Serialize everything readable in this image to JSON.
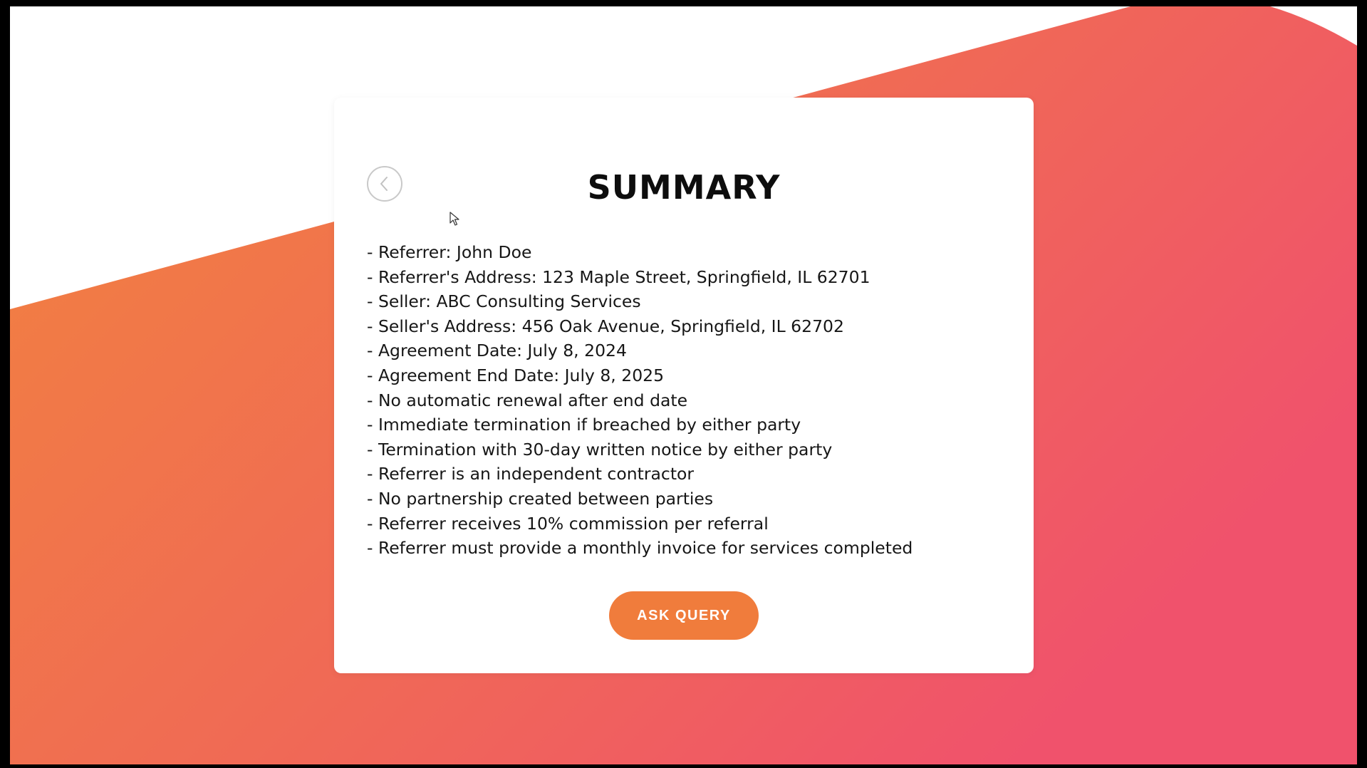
{
  "summary": {
    "title": "SUMMARY",
    "items": [
      "Referrer: John Doe",
      "Referrer's Address: 123 Maple Street, Springfield, IL 62701",
      "Seller: ABC Consulting Services",
      "Seller's Address: 456 Oak Avenue, Springfield, IL 62702",
      "Agreement Date: July 8, 2024",
      "Agreement End Date: July 8, 2025",
      "No automatic renewal after end date",
      "Immediate termination if breached by either party",
      "Termination with 30-day written notice by either party",
      "Referrer is an independent contractor",
      "No partnership created between parties",
      "Referrer receives 10% commission per referral",
      "Referrer must provide a monthly invoice for services completed"
    ],
    "ask_button_label": "ASK QUERY"
  },
  "icons": {
    "back": "chevron-left-icon",
    "cursor": "mouse-pointer-icon"
  },
  "colors": {
    "gradient_start": "#f2833f",
    "gradient_end": "#f0556a",
    "button": "#f07c3c",
    "button_text": "#ffffff",
    "title": "#0d0d0d",
    "card": "#ffffff"
  }
}
